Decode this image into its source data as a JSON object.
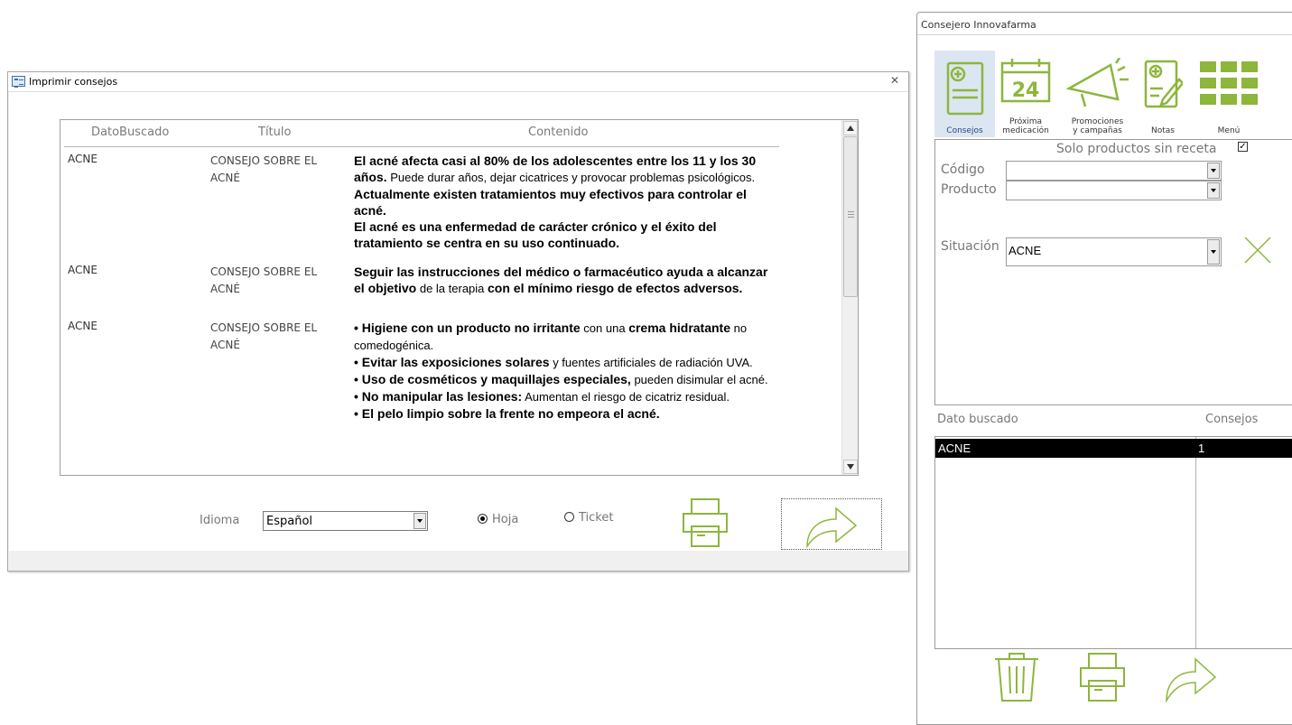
{
  "print_window": {
    "title": "Imprimir consejos",
    "columns": [
      "DatoBuscado",
      "Título",
      "Contenido"
    ],
    "rows": [
      {
        "dato": "ACNE",
        "titulo": "CONSEJO SOBRE EL ACNÉ",
        "contenido": [
          {
            "text": "El acné afecta casi al 80% de los adolescentes entre los 11 y los 30 años.",
            "bold": true
          },
          {
            "text": " Puede durar años, dejar cicatrices y provocar problemas psicológicos. ",
            "bold": false
          },
          {
            "text": "Actualmente existen tratamientos muy efectivos para controlar el acné.",
            "bold": true
          },
          {
            "text": "El acné es una enfermedad de carácter crónico y el éxito del tratamiento se centra en su uso continuado.",
            "bold": true,
            "newline": true
          }
        ]
      },
      {
        "dato": "ACNE",
        "titulo": "CONSEJO SOBRE EL ACNÉ",
        "contenido": [
          {
            "text": "Seguir las instrucciones del médico o farmacéutico ayuda a alcanzar el objetivo",
            "bold": true
          },
          {
            "text": " de la terapia ",
            "bold": false
          },
          {
            "text": "con el mínimo riesgo de efectos adversos.",
            "bold": true
          }
        ]
      },
      {
        "dato": "ACNE",
        "titulo": "CONSEJO SOBRE EL ACNÉ",
        "contenido": [
          {
            "text": "• Higiene con un producto no irritante",
            "bold": true
          },
          {
            "text": " con una ",
            "bold": false
          },
          {
            "text": "crema hidratante",
            "bold": true
          },
          {
            "text": " no comedogénica.",
            "bold": false
          },
          {
            "text": "• Evitar las exposiciones solares",
            "bold": true,
            "newline": true
          },
          {
            "text": " y fuentes artificiales de radiación UVA.",
            "bold": false
          },
          {
            "text": "• Uso de cosméticos y maquillajes especiales,",
            "bold": true,
            "newline": true
          },
          {
            "text": " pueden disimular el acné.",
            "bold": false
          },
          {
            "text": "• No manipular las lesiones:",
            "bold": true,
            "newline": true
          },
          {
            "text": " Aumentan el riesgo de cicatriz residual.",
            "bold": false
          },
          {
            "text": "• El pelo limpio sobre la frente no empeora el acné.",
            "bold": true,
            "newline": true
          }
        ]
      }
    ],
    "language_label": "Idioma",
    "language_value": "Español",
    "radio_hoja": "Hoja",
    "radio_ticket": "Ticket",
    "selected_format": "Hoja"
  },
  "advisor_window": {
    "title": "Consejero Innovafarma",
    "toolbar": {
      "consejos": "Consejos",
      "calendar_day": "24",
      "proxima_1": "Próxima",
      "proxima_2": "medicación",
      "promo_1": "Promociones",
      "promo_2": "y campañas",
      "notas": "Notas",
      "menu": "Menú"
    },
    "solo_label": "Solo productos sin receta",
    "solo_checked": true,
    "codigo_label": "Código",
    "codigo_value": "",
    "producto_label": "Producto",
    "producto_value": "",
    "situacion_label": "Situación",
    "situacion_value": "ACNE",
    "list_header_dato": "Dato buscado",
    "list_header_consejos": "Consejos",
    "list_rows": [
      {
        "dato": "ACNE",
        "consejos": "1"
      }
    ]
  },
  "colors": {
    "accent_green": "#8db63c",
    "selected_blue": "#dce6f2"
  }
}
